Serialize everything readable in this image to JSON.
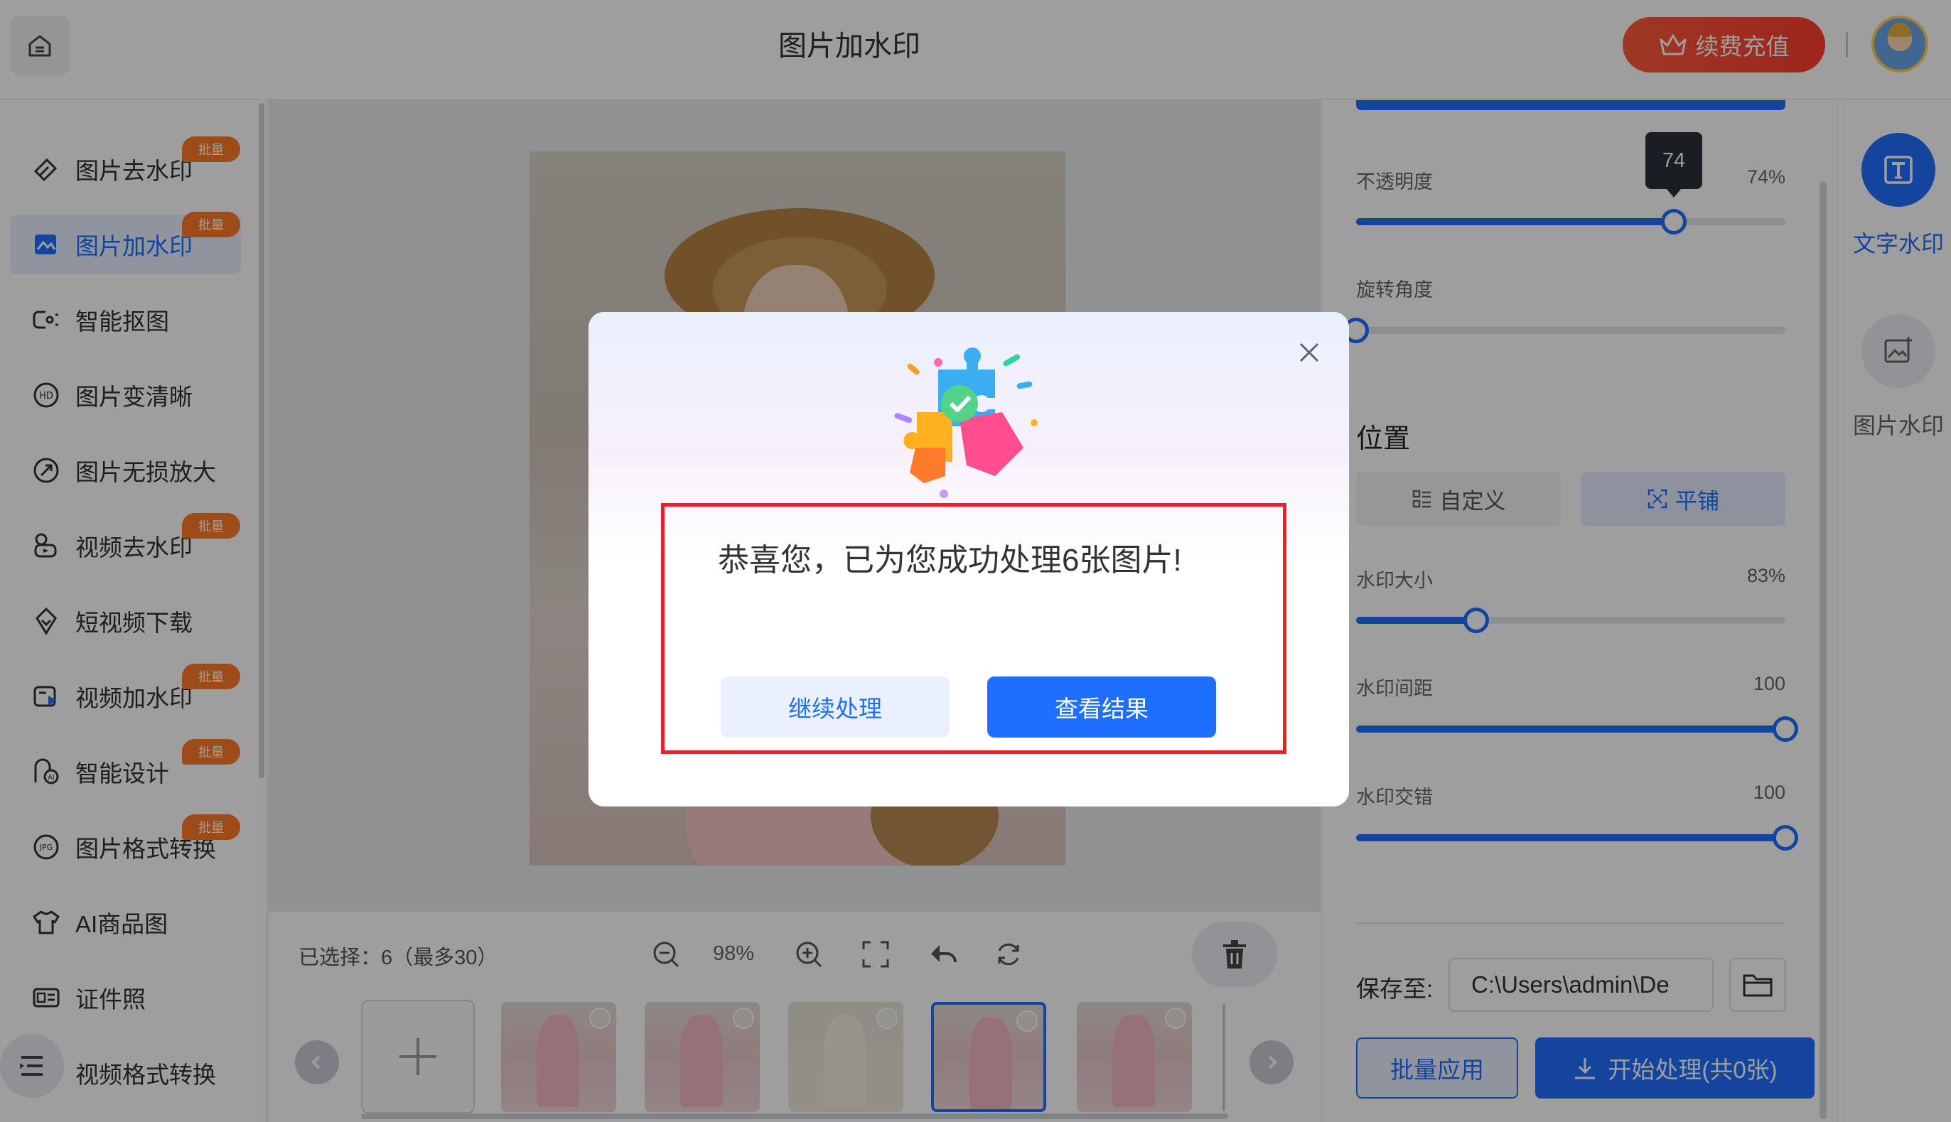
{
  "header": {
    "title": "图片加水印",
    "vip_label": "续费充值"
  },
  "sidebar": {
    "items": [
      {
        "label": "图片去水印",
        "badge": "批量",
        "icon": "eraser-icon"
      },
      {
        "label": "图片加水印",
        "badge": "批量",
        "icon": "add-watermark-icon",
        "active": true
      },
      {
        "label": "智能抠图",
        "badge": "",
        "icon": "cutout-icon"
      },
      {
        "label": "图片变清晰",
        "badge": "",
        "icon": "hd-icon"
      },
      {
        "label": "图片无损放大",
        "badge": "",
        "icon": "enlarge-icon"
      },
      {
        "label": "视频去水印",
        "badge": "批量",
        "icon": "video-eraser-icon"
      },
      {
        "label": "短视频下载",
        "badge": "",
        "icon": "download-icon"
      },
      {
        "label": "视频加水印",
        "badge": "批量",
        "icon": "video-watermark-icon"
      },
      {
        "label": "智能设计",
        "badge": "批量",
        "icon": "ai-design-icon"
      },
      {
        "label": "图片格式转换",
        "badge": "批量",
        "icon": "jpg-icon"
      },
      {
        "label": "AI商品图",
        "badge": "",
        "icon": "tshirt-icon"
      },
      {
        "label": "证件照",
        "badge": "",
        "icon": "id-card-icon"
      },
      {
        "label": "视频格式转换",
        "badge": "",
        "icon": "video-format-icon"
      }
    ]
  },
  "toolbar": {
    "selected_text": "已选择：6（最多30）",
    "zoom": "98%"
  },
  "settings": {
    "opacity": {
      "label": "不透明度",
      "value_text": "74%",
      "value": 74,
      "tooltip": "74"
    },
    "rotation": {
      "label": "旋转角度",
      "value": 0
    },
    "position_title": "位置",
    "position_custom": "自定义",
    "position_tile": "平铺",
    "size": {
      "label": "水印大小",
      "value_text": "83%",
      "value": 28
    },
    "spacing": {
      "label": "水印间距",
      "value_text": "100",
      "value": 100
    },
    "stagger": {
      "label": "水印交错",
      "value_text": "100",
      "value": 100
    },
    "save_label": "保存至:",
    "save_path": "C:\\Users\\admin\\De",
    "batch_apply": "批量应用",
    "start_process": "开始处理(共0张)"
  },
  "right_tabs": {
    "text_watermark": "文字水印",
    "image_watermark": "图片水印"
  },
  "dialog": {
    "message": "恭喜您，已为您成功处理6张图片!",
    "continue_label": "继续处理",
    "view_label": "查看结果"
  },
  "colors": {
    "primary": "#1f6fff",
    "badge": "#ff7a2a",
    "vip": "#ff4a34",
    "highlight": "#e8202a"
  }
}
